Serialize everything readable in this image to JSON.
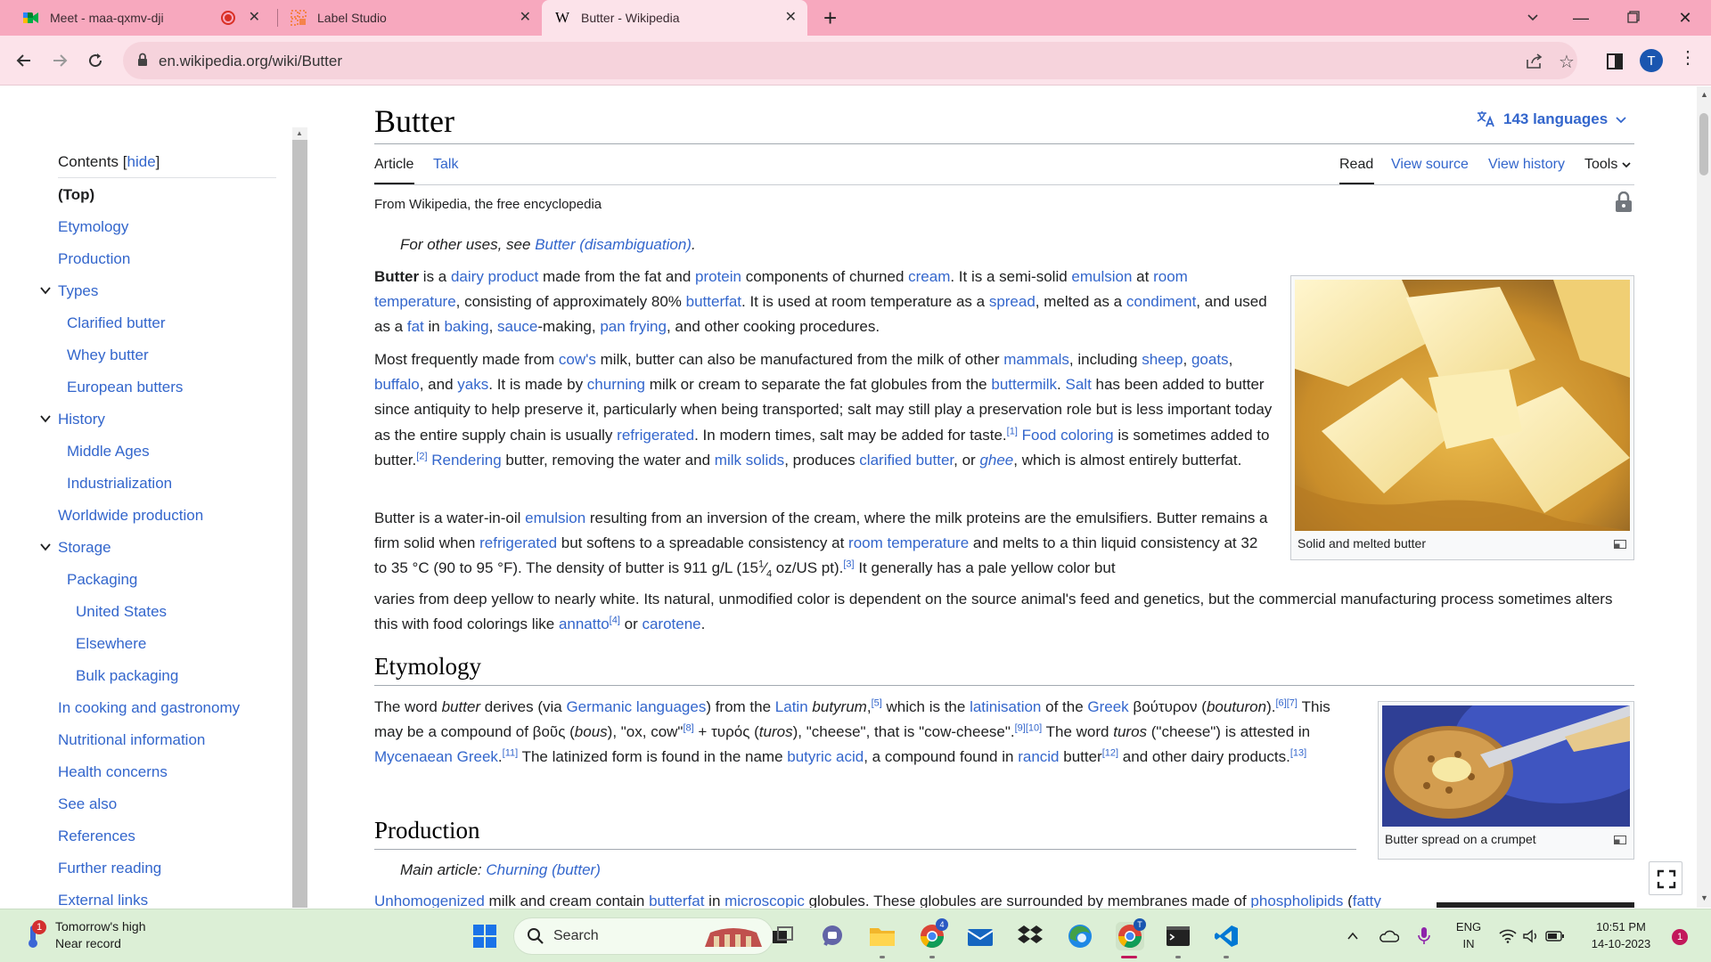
{
  "browser": {
    "tabs": [
      {
        "title": "Meet - maa-qxmv-dji",
        "recording": true
      },
      {
        "title": "Label Studio"
      },
      {
        "title": "Butter - Wikipedia",
        "active": true
      }
    ],
    "url": "en.wikipedia.org/wiki/Butter",
    "profile_initial": "T"
  },
  "toc": {
    "heading": "Contents",
    "hide_label": "[hide]",
    "items": [
      {
        "label": "(Top)",
        "level": 0,
        "current": true
      },
      {
        "label": "Etymology",
        "level": 0
      },
      {
        "label": "Production",
        "level": 0
      },
      {
        "label": "Types",
        "level": 0,
        "expanded": true
      },
      {
        "label": "Clarified butter",
        "level": 1
      },
      {
        "label": "Whey butter",
        "level": 1
      },
      {
        "label": "European butters",
        "level": 1
      },
      {
        "label": "History",
        "level": 0,
        "expanded": true
      },
      {
        "label": "Middle Ages",
        "level": 1
      },
      {
        "label": "Industrialization",
        "level": 1
      },
      {
        "label": "Worldwide production",
        "level": 0
      },
      {
        "label": "Storage",
        "level": 0,
        "expanded": true
      },
      {
        "label": "Packaging",
        "level": 1
      },
      {
        "label": "United States",
        "level": 2
      },
      {
        "label": "Elsewhere",
        "level": 2
      },
      {
        "label": "Bulk packaging",
        "level": 2
      },
      {
        "label": "In cooking and gastronomy",
        "level": 0
      },
      {
        "label": "Nutritional information",
        "level": 0
      },
      {
        "label": "Health concerns",
        "level": 0
      },
      {
        "label": "See also",
        "level": 0
      },
      {
        "label": "References",
        "level": 0
      },
      {
        "label": "Further reading",
        "level": 0
      },
      {
        "label": "External links",
        "level": 0
      }
    ]
  },
  "article": {
    "title": "Butter",
    "languages": "143 languages",
    "tabs_left": [
      "Article",
      "Talk"
    ],
    "tabs_right": [
      "Read",
      "View source",
      "View history",
      "Tools"
    ],
    "tagline": "From Wikipedia, the free encyclopedia",
    "hatnote_prefix": "For other uses, see ",
    "hatnote_link": "Butter (disambiguation)",
    "hatnote_suffix": ".",
    "etymology_heading": "Etymology",
    "production_heading": "Production",
    "main_article_prefix": "Main article: ",
    "main_article_link": "Churning (butter)",
    "figure1_caption": "Solid and melted butter",
    "figure2_caption": "Butter spread on a crumpet"
  },
  "taskbar": {
    "weather_line1": "Tomorrow's high",
    "weather_line2": "Near record",
    "weather_badge": "1",
    "search_label": "Search",
    "lang_line1": "ENG",
    "lang_line2": "IN",
    "time": "10:51 PM",
    "date": "14-10-2023",
    "notification_count": "1",
    "chrome_badge": "T",
    "edge_chrome_badge": "4"
  },
  "colors": {
    "tabstrip": "#f7a8be",
    "toolbar": "#fce3ea",
    "link": "#3366cc",
    "taskbar": "#dcefd6"
  }
}
